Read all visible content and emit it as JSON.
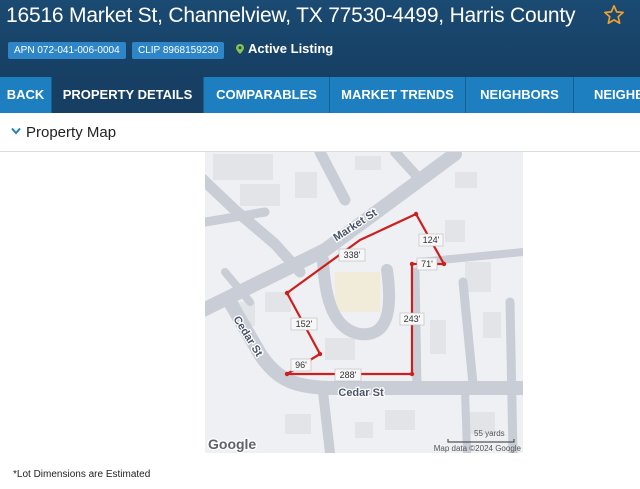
{
  "header": {
    "address": "16516 Market St, Channelview, TX 77530-4499, Harris County",
    "apn": "APN 072-041-006-0004",
    "clip": "CLIP 8968159230",
    "status": "Active Listing",
    "status_color": "#8bc34a",
    "favorite_icon": "star-icon"
  },
  "nav": {
    "tabs": [
      {
        "label": "BACK",
        "active": false
      },
      {
        "label": "PROPERTY DETAILS",
        "active": true
      },
      {
        "label": "COMPARABLES",
        "active": false
      },
      {
        "label": "MARKET TRENDS",
        "active": false
      },
      {
        "label": "NEIGHBORS",
        "active": false
      },
      {
        "label": "NEIGHBO",
        "active": false
      }
    ]
  },
  "section": {
    "title": "Property Map",
    "toggle_icon": "chevron-down-icon"
  },
  "map": {
    "streets": [
      "Market St",
      "Cedar St",
      "Cedar St"
    ],
    "dimensions": [
      "124'",
      "338'",
      "71'",
      "152'",
      "243'",
      "96'",
      "288'"
    ],
    "scale": "55 yards",
    "attribution": "Map data ©2024 Google",
    "logo": "Google",
    "boundary_color": "#cc1f1f"
  },
  "footnote": "*Lot Dimensions are Estimated"
}
